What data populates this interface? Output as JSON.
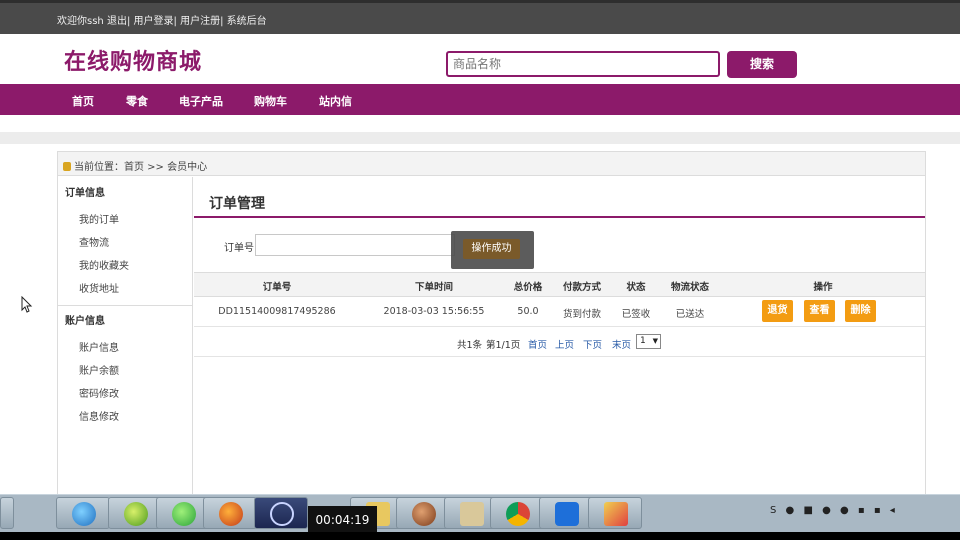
{
  "topbar": {
    "welcome": "欢迎你ssh",
    "logout": "退出",
    "sep1": "|",
    "login": "用户登录",
    "sep2": "|",
    "register": "用户注册",
    "sep3": "|",
    "admin": "系统后台"
  },
  "header": {
    "logo": "在线购物商城",
    "search_placeholder": "商品名称",
    "search_button": "搜索"
  },
  "nav": {
    "items": [
      "首页",
      "零食",
      "电子产品",
      "购物车",
      "站内信"
    ]
  },
  "breadcrumb": {
    "text": "当前位置：首页 >> 会员中心"
  },
  "sidebar": {
    "sections": [
      {
        "title": "订单信息",
        "items": [
          "我的订单",
          "查物流",
          "我的收藏夹",
          "收货地址"
        ]
      },
      {
        "title": "账户信息",
        "items": [
          "账户信息",
          "账户余额",
          "密码修改",
          "信息修改"
        ]
      }
    ]
  },
  "main": {
    "title": "订单管理",
    "order_label": "订单号",
    "toast": "操作成功",
    "table": {
      "headers": [
        "订单号",
        "下单时间",
        "总价格",
        "付款方式",
        "状态",
        "物流状态",
        "操作"
      ],
      "rows": [
        {
          "order_no": "DD11514009817495286",
          "time": "2018-03-03 15:56:55",
          "total": "50.0",
          "payment": "货到付款",
          "status": "已签收",
          "logistics": "已送达",
          "actions": [
            "退货",
            "查看",
            "删除"
          ]
        }
      ]
    },
    "pager": {
      "total": "共1条",
      "page_info": "第1/1页",
      "first": "首页",
      "prev": "上页",
      "next": "下页",
      "last": "末页",
      "current": "1"
    }
  },
  "taskbar": {
    "timer": "00:04:19",
    "tray_text": "S"
  },
  "colors": {
    "brand": "#8c1a6a",
    "action": "#f39c12",
    "topbar": "#4a4a4a"
  }
}
